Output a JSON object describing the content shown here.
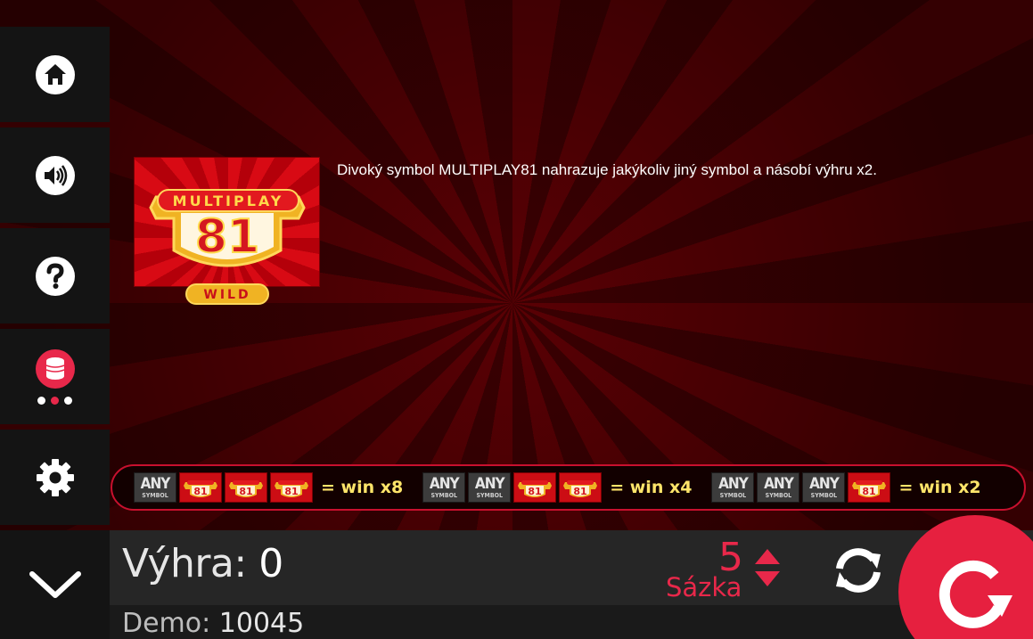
{
  "sidebar": {
    "items": [
      {
        "name": "home",
        "icon": "home-icon"
      },
      {
        "name": "sound",
        "icon": "speaker-icon"
      },
      {
        "name": "help",
        "icon": "question-icon"
      },
      {
        "name": "bet",
        "icon": "coins-icon",
        "active": true
      },
      {
        "name": "settings",
        "icon": "gear-icon"
      }
    ],
    "accent_color": "#e8284a"
  },
  "info": {
    "wild_symbol": {
      "top_text": "MULTIPLAY",
      "number": "81",
      "bottom_text": "WILD"
    },
    "description": "Divoký symbol MULTIPLAY81 nahrazuje jakýkoliv jiný symbol a násobí výhru x2."
  },
  "paytable": {
    "any_top": "ANY",
    "any_bottom": "SYMBOL",
    "combos": [
      {
        "tiles": [
          "any",
          "wild",
          "wild",
          "wild"
        ],
        "label": "= win x8"
      },
      {
        "tiles": [
          "any",
          "any",
          "wild",
          "wild"
        ],
        "label": "= win x4"
      },
      {
        "tiles": [
          "any",
          "any",
          "any",
          "wild"
        ],
        "label": "= win x2"
      }
    ]
  },
  "bottom": {
    "win_label": "Výhra:",
    "win_value": "0",
    "demo_label": "Demo:",
    "demo_value": "10045",
    "bet_value": "5",
    "bet_label": "Sázka"
  }
}
